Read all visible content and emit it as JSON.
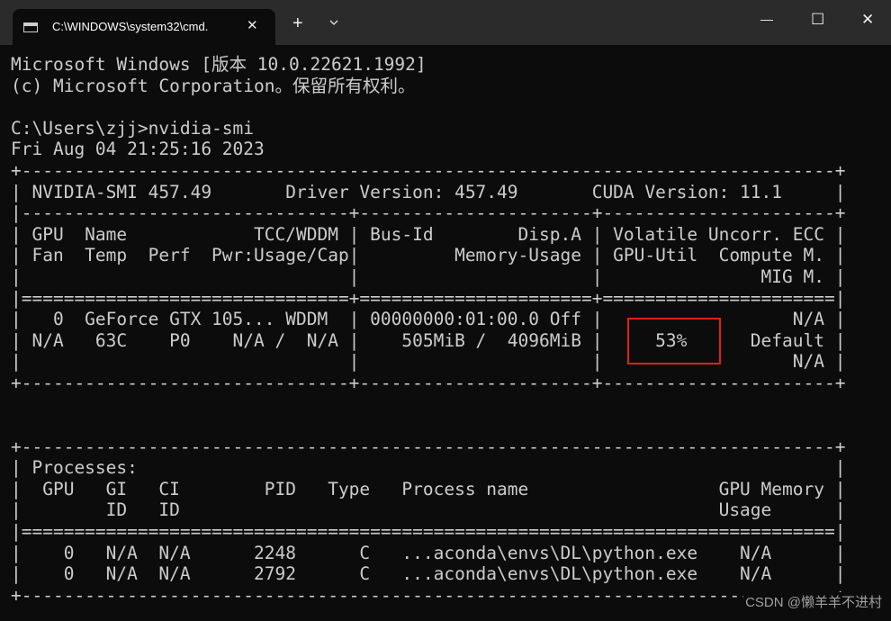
{
  "window": {
    "tab_title": "C:\\WINDOWS\\system32\\cmd.",
    "tab_close": "✕",
    "new_tab": "+",
    "minimize": "—",
    "maximize": "☐",
    "close": "✕"
  },
  "terminal": {
    "lines": [
      "Microsoft Windows [版本 10.0.22621.1992]",
      "(c) Microsoft Corporation。保留所有权利。",
      "",
      "C:\\Users\\zjj>nvidia-smi",
      "Fri Aug 04 21:25:16 2023",
      "+-----------------------------------------------------------------------------+",
      "| NVIDIA-SMI 457.49       Driver Version: 457.49       CUDA Version: 11.1     |",
      "|-------------------------------+----------------------+----------------------+",
      "| GPU  Name            TCC/WDDM | Bus-Id        Disp.A | Volatile Uncorr. ECC |",
      "| Fan  Temp  Perf  Pwr:Usage/Cap|         Memory-Usage | GPU-Util  Compute M. |",
      "|                               |                      |               MIG M. |",
      "|===============================+======================+======================|",
      "|   0  GeForce GTX 105... WDDM  | 00000000:01:00.0 Off |                  N/A |",
      "| N/A   63C    P0    N/A /  N/A |    505MiB /  4096MiB |     53%      Default |",
      "|                               |                      |                  N/A |",
      "+-------------------------------+----------------------+----------------------+",
      "",
      "",
      "+-----------------------------------------------------------------------------+",
      "| Processes:                                                                  |",
      "|  GPU   GI   CI        PID   Type   Process name                  GPU Memory |",
      "|        ID   ID                                                   Usage      |",
      "|=============================================================================|",
      "|    0   N/A  N/A      2248      C   ...aconda\\envs\\DL\\python.exe    N/A      |",
      "|    0   N/A  N/A      2792      C   ...aconda\\envs\\DL\\python.exe    N/A      |",
      "+-----------------------------------------------------------------------------+"
    ]
  },
  "watermark": "CSDN @懒羊羊不进村",
  "colors": {
    "background": "#0c0c0c",
    "text": "#cccccc",
    "titlebar": "#2b2b2b",
    "highlight_box": "#e02020"
  }
}
